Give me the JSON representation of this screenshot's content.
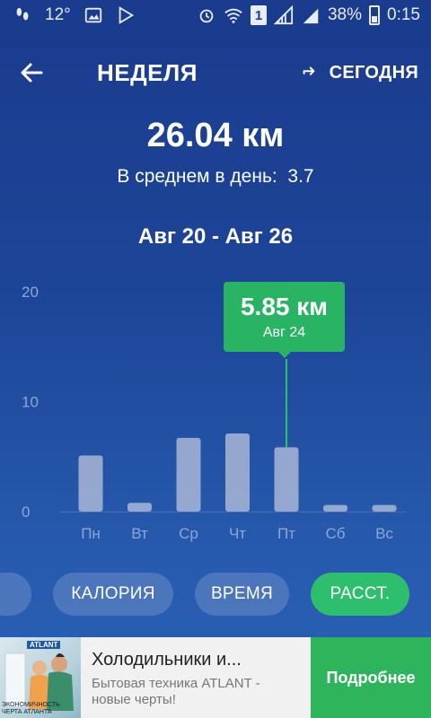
{
  "status_bar": {
    "temperature": "12°",
    "battery_percent": "38%",
    "time": "0:15",
    "sim_slot": "1",
    "icons_left": [
      "footsteps-icon",
      "image-icon",
      "play-store-icon"
    ],
    "icons_right": [
      "alarm-icon",
      "wifi-icon",
      "signal-icon",
      "signal-icon-2",
      "battery-icon"
    ]
  },
  "header": {
    "back_icon": "arrow-left-icon",
    "title": "НЕДЕЛЯ",
    "today_icon": "return-icon",
    "today_label": "СЕГОДНЯ"
  },
  "summary": {
    "total": "26.04 км",
    "average_label": "В среднем в день:",
    "average_value": "3.7",
    "date_range": "Авг 20 - Авг 26"
  },
  "tooltip": {
    "value": "5.85 км",
    "date": "Авг 24"
  },
  "chart_data": {
    "type": "bar",
    "categories": [
      "Пн",
      "Вт",
      "Ср",
      "Чт",
      "Пт",
      "Сб",
      "Вс"
    ],
    "values": [
      5.1,
      0.8,
      6.7,
      7.1,
      5.85,
      0.6,
      0.6
    ],
    "yticks": [
      "0",
      "10",
      "20"
    ],
    "ylim": [
      0,
      20
    ],
    "highlighted_category": "Пт",
    "colors": {
      "bar": "#a9b6d6",
      "highlight_line": "#2ebf6e"
    }
  },
  "chips": {
    "first_label": "",
    "calories": "КАЛОРИЯ",
    "time": "ВРЕМЯ",
    "distance": "РАССТ.",
    "active_color": "#2ebf6e"
  },
  "ad": {
    "brand": "ATLANT",
    "image_caption": "ЭКОНОМИЧНОСТЬ ЧЕРТА АТЛАНТА",
    "title": "Холодильники и...",
    "description": "Бытовая техника ATLANT - новые черты!",
    "cta": "Подробнее"
  }
}
